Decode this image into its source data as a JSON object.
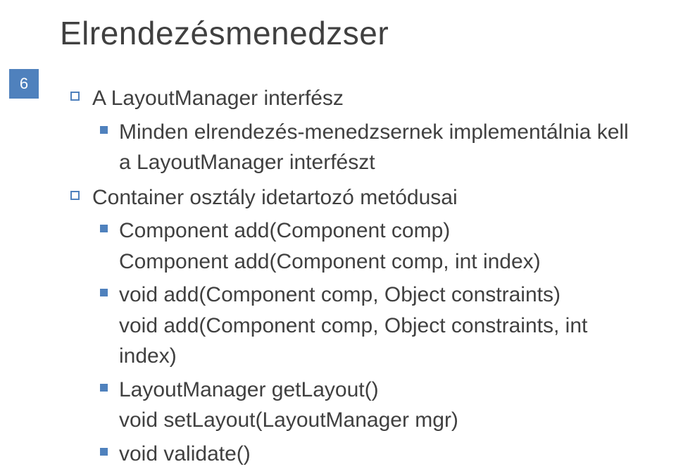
{
  "page_number": "6",
  "title": "Elrendezésmenedzser",
  "content": {
    "lvl1_a": "A LayoutManager interfész",
    "lvl2_a": "Minden elrendezés-menedzsernek implementálnia kell a LayoutManager interfészt",
    "lvl1_b": "Container osztály idetartozó metódusai",
    "lvl2_b": "Component add(Component comp)",
    "lvl2_b_line2": "Component add(Component comp, int index)",
    "lvl2_c": "void add(Component comp, Object constraints)",
    "lvl2_c_line2": "void add(Component comp, Object constraints, int index)",
    "lvl2_d": "LayoutManager getLayout()",
    "lvl2_d_line2": "void setLayout(LayoutManager mgr)",
    "lvl2_e": "void validate()"
  }
}
